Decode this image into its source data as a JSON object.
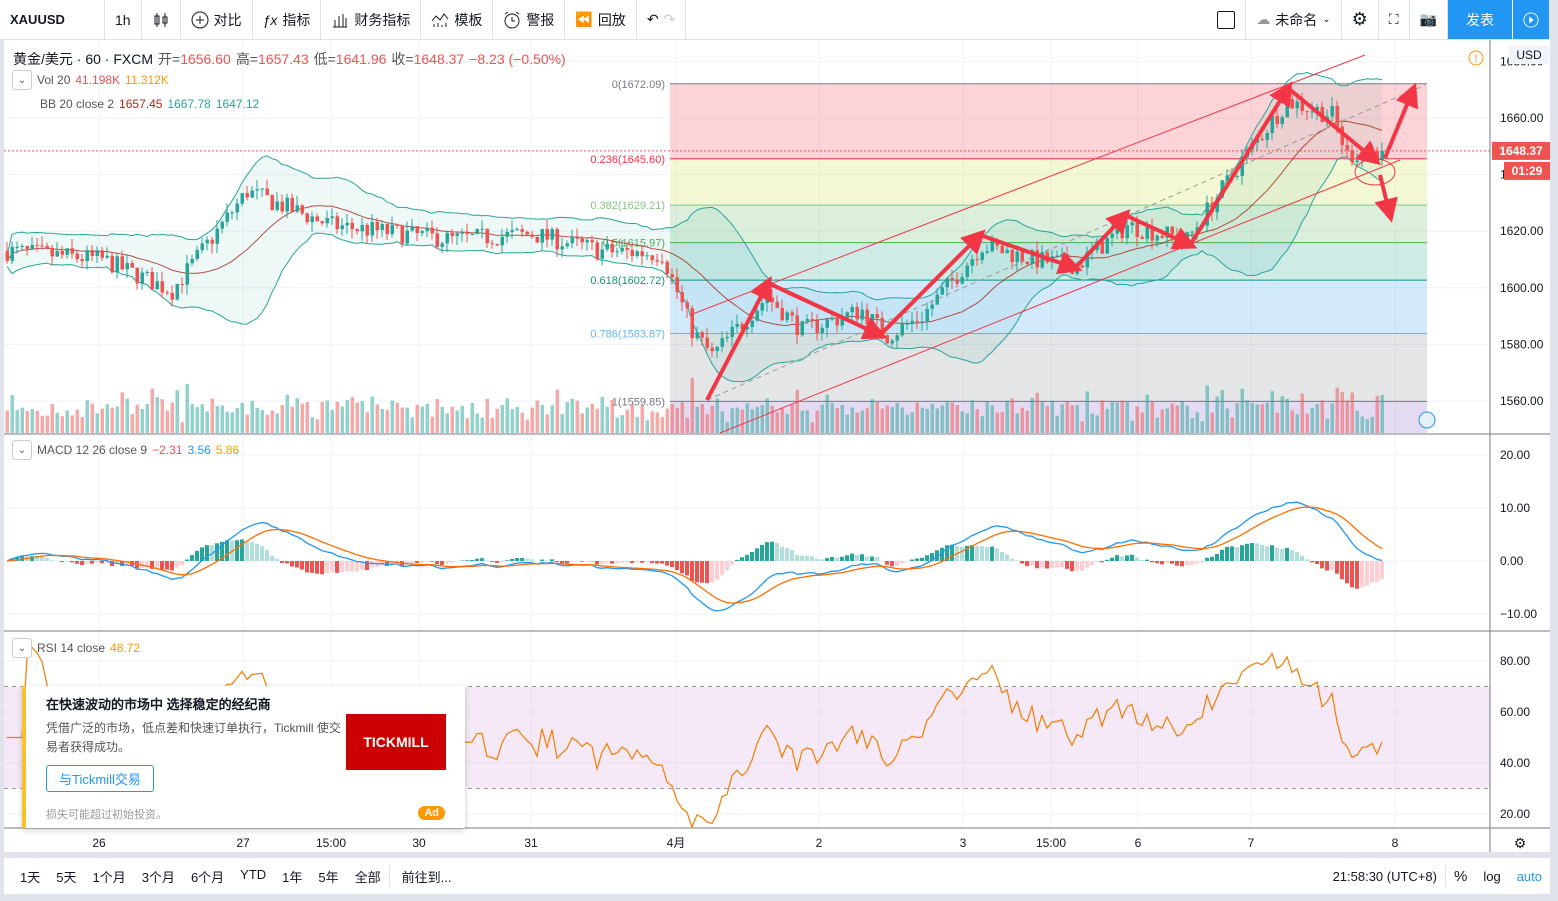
{
  "toolbar": {
    "symbol": "XAUUSD",
    "interval": "1h",
    "compare": "对比",
    "indicators": "指标",
    "financials": "财务指标",
    "templates": "模板",
    "alerts": "警报",
    "replay": "回放",
    "layout_name": "未命名",
    "publish": "发表"
  },
  "legend": {
    "title": "黄金/美元 · 60 · FXCM",
    "open_label": "开=",
    "open": "1656.60",
    "high_label": "高=",
    "high": "1657.43",
    "low_label": "低=",
    "low": "1641.96",
    "close_label": "收=",
    "close": "1648.37",
    "change": "−8.23 (−0.50%)",
    "vol": {
      "name": "Vol 20",
      "v1": "41.198K",
      "v2": "11.312K"
    },
    "bb": {
      "name": "BB 20 close 2",
      "basis": "1657.45",
      "upper": "1667.78",
      "lower": "1647.12"
    },
    "macd": {
      "name": "MACD 12 26 close 9",
      "hist": "−2.31",
      "macd": "3.56",
      "signal": "5.86"
    },
    "rsi": {
      "name": "RSI 14 close",
      "value": "48.72"
    }
  },
  "price_axis": {
    "currency": "USD",
    "last_price": "1648.37",
    "countdown": "01:29",
    "main_ticks": [
      "1680.00",
      "1660.00",
      "1640.00",
      "1620.00",
      "1600.00",
      "1580.00",
      "1560.00"
    ],
    "macd_ticks": [
      "20.00",
      "10.00",
      "0.00",
      "−10.00"
    ],
    "rsi_ticks": [
      "80.00",
      "60.00",
      "40.00",
      "20.00"
    ]
  },
  "time_axis": [
    "26",
    "27",
    "15:00",
    "30",
    "31",
    "4月",
    "2",
    "3",
    "15:00",
    "6",
    "7",
    "8"
  ],
  "fib": [
    {
      "label": "0(1672.09)",
      "level": 0,
      "price": 1672.09,
      "color": "#787b86"
    },
    {
      "label": "0.236(1645.60)",
      "level": 0.236,
      "price": 1645.6,
      "color": "#f23645"
    },
    {
      "label": "0.382(1629.21)",
      "level": 0.382,
      "price": 1629.21,
      "color": "#81c784"
    },
    {
      "label": "0.5(1615.97)",
      "level": 0.5,
      "price": 1615.97,
      "color": "#4caf50"
    },
    {
      "label": "0.618(1602.72)",
      "level": 0.618,
      "price": 1602.72,
      "color": "#089981"
    },
    {
      "label": "0.786(1583.87)",
      "level": 0.786,
      "price": 1583.87,
      "color": "#64b5f6"
    },
    {
      "label": "1(1559.85)",
      "level": 1,
      "price": 1559.85,
      "color": "#787b86"
    }
  ],
  "ad": {
    "title": "在快速波动的市场中 选择稳定的经纪商",
    "desc": "凭借广泛的市场，低点差和快速订单执行，Tickmill 使交易者获得成功。",
    "cta": "与Tickmill交易",
    "disclaimer": "损失可能超过初始投资。",
    "brand": "TICKMILL",
    "tag": "Ad"
  },
  "bottom": {
    "ranges": [
      "1天",
      "5天",
      "1个月",
      "3个月",
      "6个月",
      "YTD",
      "1年",
      "5年",
      "全部"
    ],
    "goto": "前往到...",
    "clock": "21:58:30 (UTC+8)",
    "percent": "%",
    "log": "log",
    "auto": "auto"
  },
  "colors": {
    "up": "#26a69a",
    "down": "#ef5350",
    "accent": "#2196f3"
  },
  "chart_data": {
    "type": "candlestick",
    "symbol": "XAUUSD",
    "interval": "60",
    "bar_count": 276,
    "close_keypoints": [
      [
        0,
        1613
      ],
      [
        19,
        1610
      ],
      [
        33,
        1599
      ],
      [
        48,
        1634
      ],
      [
        65,
        1622
      ],
      [
        89,
        1617
      ],
      [
        105,
        1619
      ],
      [
        119,
        1613
      ],
      [
        131,
        1612
      ],
      [
        137,
        1585
      ],
      [
        141,
        1576
      ],
      [
        152,
        1597
      ],
      [
        159,
        1585
      ],
      [
        171,
        1592
      ],
      [
        176,
        1583
      ],
      [
        183,
        1590
      ],
      [
        195,
        1615
      ],
      [
        205,
        1610
      ],
      [
        214,
        1608
      ],
      [
        224,
        1622
      ],
      [
        236,
        1617
      ],
      [
        247,
        1645
      ],
      [
        256,
        1666
      ],
      [
        265,
        1661
      ],
      [
        268,
        1647
      ],
      [
        275,
        1648.37
      ]
    ],
    "price_range": [
      1550,
      1690
    ],
    "macd_range": [
      -14,
      22
    ],
    "rsi_range": [
      14,
      92
    ],
    "rsi_bands": [
      30,
      70
    ],
    "last_close": 1648.37
  }
}
